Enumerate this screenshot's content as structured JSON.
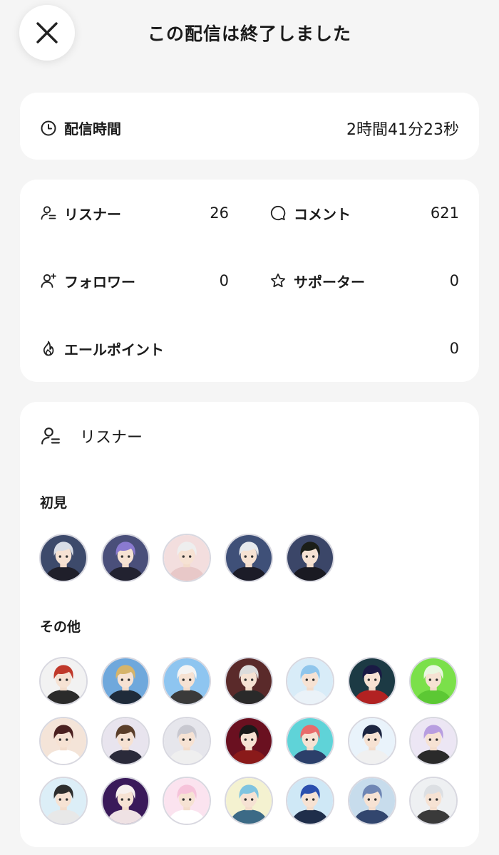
{
  "header": {
    "title": "この配信は終了しました",
    "close_icon": "close-icon"
  },
  "duration": {
    "label": "配信時間",
    "value": "2時間41分23秒",
    "icon": "clock-icon"
  },
  "stats": {
    "listeners": {
      "label": "リスナー",
      "value": "26",
      "icon": "person-list-icon"
    },
    "comments": {
      "label": "コメント",
      "value": "621",
      "icon": "comment-bubble-icon"
    },
    "followers": {
      "label": "フォロワー",
      "value": "0",
      "icon": "person-add-icon"
    },
    "supporters": {
      "label": "サポーター",
      "value": "0",
      "icon": "star-icon"
    },
    "cheer_points": {
      "label": "エールポイント",
      "value": "0",
      "icon": "flame-icon"
    }
  },
  "listeners_section": {
    "title": "リスナー",
    "icon": "person-list-icon",
    "first_time": {
      "label": "初見",
      "avatars": [
        {
          "bg": "#3d4a6b",
          "hair": "#d9dde6",
          "cloth": "#1f1f2a"
        },
        {
          "bg": "#4a4f7a",
          "hair": "#8a7ad0",
          "cloth": "#222230"
        },
        {
          "bg": "#f3dede",
          "hair": "#eeeeee",
          "cloth": "#e8c8c8"
        },
        {
          "bg": "#3f5078",
          "hair": "#e6e9ee",
          "cloth": "#1c1c28"
        },
        {
          "bg": "#3b4668",
          "hair": "#1b1e18",
          "cloth": "#1a1a22"
        }
      ]
    },
    "others": {
      "label": "その他",
      "avatars": [
        {
          "bg": "#f2f2f2",
          "hair": "#c0392b",
          "cloth": "#2b2b2b"
        },
        {
          "bg": "#6fa8dc",
          "hair": "#d6b46a",
          "cloth": "#1f2b3a"
        },
        {
          "bg": "#8ec5f0",
          "hair": "#f4f4f4",
          "cloth": "#3a3a3a"
        },
        {
          "bg": "#5a2a2a",
          "hair": "#dcdcdc",
          "cloth": "#2a2a2a"
        },
        {
          "bg": "#d8ecf8",
          "hair": "#8fc6ec",
          "cloth": "#eaf2f8"
        },
        {
          "bg": "#1c3a44",
          "hair": "#1a1a44",
          "cloth": "#b22222"
        },
        {
          "bg": "#7be04a",
          "hair": "#e9f7e0",
          "cloth": "#5cc834"
        },
        {
          "bg": "#f4e4d8",
          "hair": "#4a2020",
          "cloth": "#ffffff"
        },
        {
          "bg": "#e8e4ee",
          "hair": "#5a3e2a",
          "cloth": "#2a2a3a"
        },
        {
          "bg": "#e6e6ec",
          "hair": "#c8c8d0",
          "cloth": "#efefef"
        },
        {
          "bg": "#6a1020",
          "hair": "#1a1a1a",
          "cloth": "#8a1a1a"
        },
        {
          "bg": "#5fd3d8",
          "hair": "#e86b6b",
          "cloth": "#2c3f6a"
        },
        {
          "bg": "#e9f3fb",
          "hair": "#1c2540",
          "cloth": "#f0f0f0"
        },
        {
          "bg": "#ece6f4",
          "hair": "#b89ee0",
          "cloth": "#2a2a2a"
        },
        {
          "bg": "#dceef7",
          "hair": "#2d2d2d",
          "cloth": "#e8e8e8"
        },
        {
          "bg": "#3a1a5a",
          "hair": "#f7f0ee",
          "cloth": "#efe2e4"
        },
        {
          "bg": "#fbe3ef",
          "hair": "#f6c3da",
          "cloth": "#ffffff"
        },
        {
          "bg": "#f4f2d0",
          "hair": "#7fc4e0",
          "cloth": "#3c6a86"
        },
        {
          "bg": "#cfe8f6",
          "hair": "#2a4fae",
          "cloth": "#1f2e4a"
        },
        {
          "bg": "#c7dcec",
          "hair": "#6f86b4",
          "cloth": "#32466e"
        },
        {
          "bg": "#eef0f2",
          "hair": "#dcdfe3",
          "cloth": "#3a3a3a"
        }
      ]
    }
  }
}
